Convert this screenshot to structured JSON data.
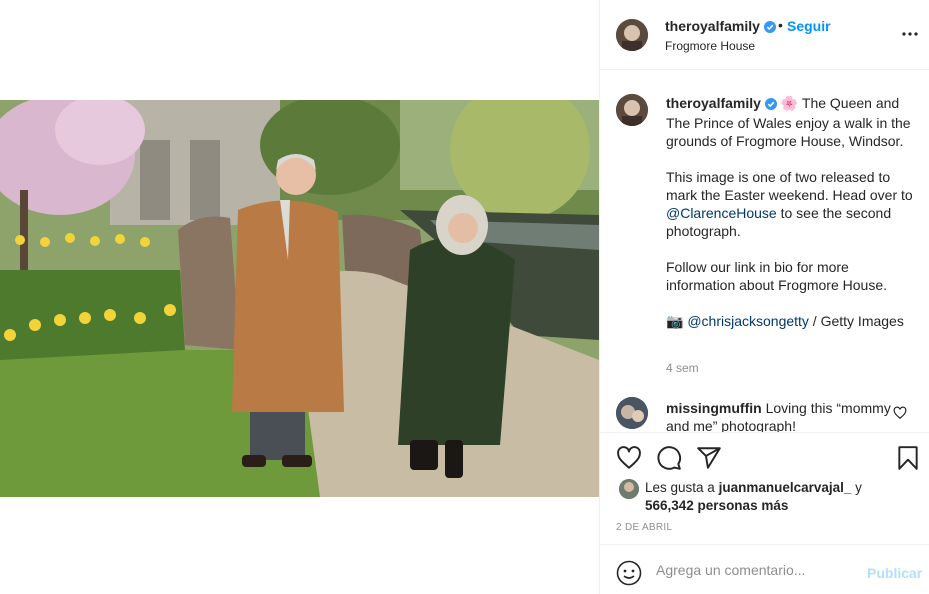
{
  "post": {
    "username": "theroyalfamily",
    "follow_label": "Seguir",
    "separator": "•",
    "location": "Frogmore House",
    "more_icon": "more-options-icon",
    "verified_color": "#3897f0"
  },
  "caption": {
    "username": "theroyalfamily",
    "emoji": "🌸",
    "line1": "The Queen and The Prince of Wales enjoy a walk in the grounds of Frogmore House, Windsor.",
    "line2_pre": "This image is one of two released to mark the Easter weekend. Head over to ",
    "line2_link": "@ClarenceHouse",
    "line2_post": " to see the second photograph.",
    "line3": "Follow our link in bio for more information about Frogmore House.",
    "camera_emoji": "📷",
    "credit_link": "@chrisjacksongetty",
    "credit_post": " / Getty Images",
    "age": "4 sem"
  },
  "comment": {
    "username": "missingmuffin",
    "text": "Loving this “mommy and me” photograph!"
  },
  "actions": {
    "like_icon": "heart-icon",
    "comment_icon": "comment-icon",
    "share_icon": "share-icon",
    "save_icon": "bookmark-icon"
  },
  "likes": {
    "prefix": "Les gusta a",
    "user": "juanmanuelcarvajal_",
    "conj": "y",
    "count": "566,342 personas más"
  },
  "date": "2 DE ABRIL",
  "add_comment": {
    "placeholder": "Agrega un comentario...",
    "publish_label": "Publicar"
  },
  "colors": {
    "accent": "#0095f6",
    "link": "#00376b",
    "muted": "#8e8e8e",
    "publish_disabled": "#b2dffc"
  }
}
